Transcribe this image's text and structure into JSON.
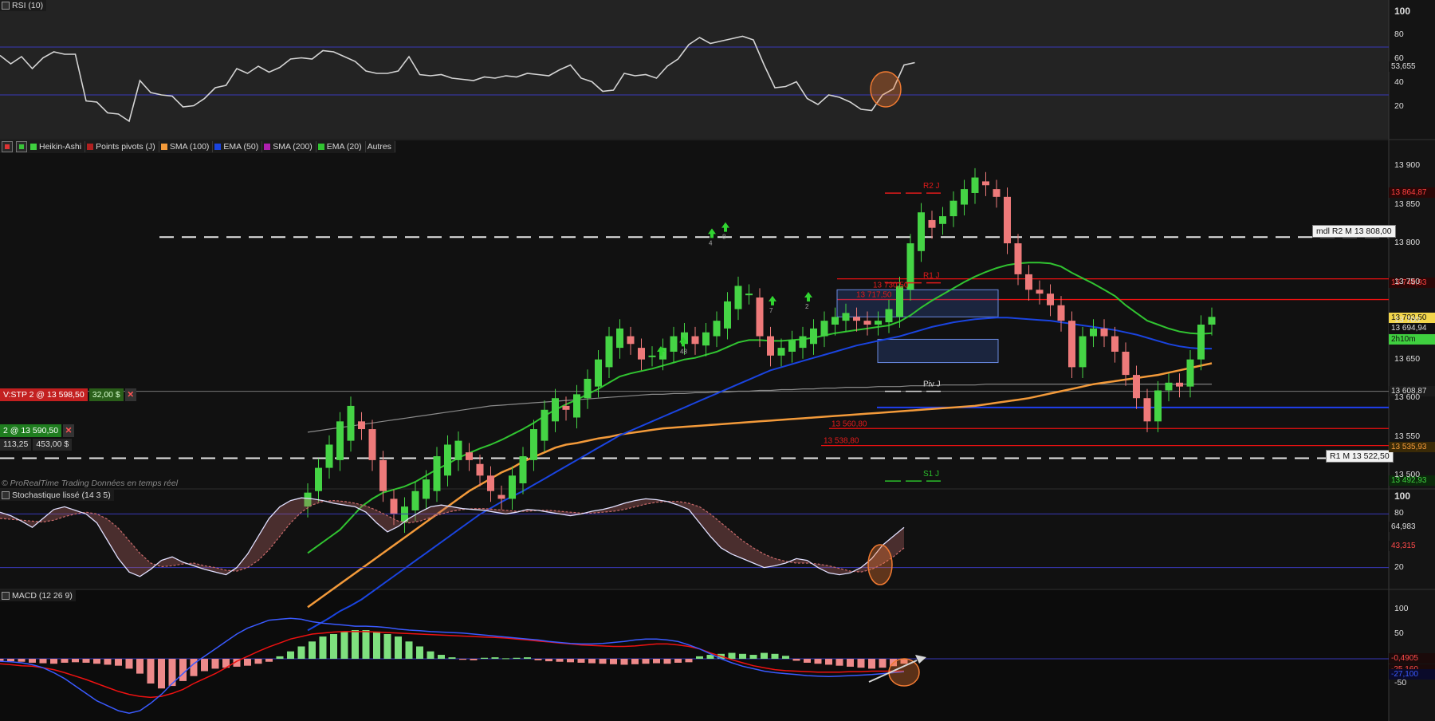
{
  "rsi": {
    "title": "RSI (10)",
    "axis": [
      "100",
      "80",
      "60",
      "40",
      "20"
    ],
    "value_tag": "53,655",
    "series": [
      63,
      56,
      62,
      52,
      61,
      66,
      64,
      64,
      25,
      24,
      15,
      14,
      8,
      42,
      32,
      30,
      29,
      20,
      21,
      27,
      36,
      38,
      52,
      48,
      54,
      49,
      53,
      60,
      61,
      60,
      67,
      66,
      62,
      58,
      50,
      48,
      48,
      50,
      62,
      47,
      46,
      47,
      44,
      43,
      42,
      45,
      44,
      46,
      45,
      48,
      47,
      46,
      51,
      55,
      44,
      41,
      33,
      34,
      48,
      46,
      47,
      44,
      54,
      60,
      72,
      78,
      73,
      75,
      77,
      79,
      76,
      55,
      36,
      37,
      41,
      27,
      22,
      30,
      28,
      24,
      18,
      17,
      30,
      35,
      55,
      57
    ]
  },
  "price": {
    "legend": [
      {
        "label": "Heikin-Ashi",
        "color": "#3fcf3f"
      },
      {
        "label": "Points pivots (J)",
        "color": "#b02020"
      },
      {
        "label": "SMA (100)",
        "color": "#f39a3a"
      },
      {
        "label": "EMA (50)",
        "color": "#1a44e0"
      },
      {
        "label": "SMA (200)",
        "color": "#b020b0"
      },
      {
        "label": "EMA (20)",
        "color": "#31c431"
      },
      {
        "label": "Autres",
        "color": ""
      }
    ],
    "axis": [
      "13 900",
      "13 850",
      "13 800",
      "13 750",
      "13 700",
      "13 650",
      "13 600",
      "13 550",
      "13 500"
    ],
    "tags": [
      {
        "text": "13 864,87",
        "price": 13864.87,
        "bg": "#2a0707",
        "fg": "#ff4040"
      },
      {
        "text": "13 748,93",
        "price": 13748.93,
        "bg": "#2a0707",
        "fg": "#ff4040"
      },
      {
        "text": "13 703,50",
        "price": 13703.5,
        "bg": "#f2d54a",
        "fg": "#111"
      },
      {
        "text": "13 694,94",
        "price": 13690,
        "bg": "#111",
        "fg": "#ddd"
      },
      {
        "text": "2h10m",
        "price": 13675,
        "bg": "#3fcf3f",
        "fg": "#111"
      },
      {
        "text": "13 608,87",
        "price": 13608.87,
        "bg": "#1b1b1b",
        "fg": "#ddd"
      },
      {
        "text": "13 535,93",
        "price": 13535.93,
        "bg": "#3a2a07",
        "fg": "#f39a3a"
      },
      {
        "text": "13 492,93",
        "price": 13492.93,
        "bg": "#0b2a0b",
        "fg": "#3fcf3f"
      }
    ],
    "pivots": [
      {
        "label": "R2 J",
        "price": 13864.87
      },
      {
        "label": "R1 J",
        "price": 13748.93
      },
      {
        "label": "Piv J",
        "price": 13608.87
      },
      {
        "label": "S1 J",
        "price": 13492.93
      }
    ],
    "levels": [
      {
        "label": "mdl R2 M 13 808,00",
        "price": 13808
      },
      {
        "label": "R1 M 13 522,50",
        "price": 13522.5
      }
    ],
    "red_lines": [
      {
        "label": "13 730,50",
        "price": 13730.5
      },
      {
        "label": "13 717,50",
        "price": 13717.5
      },
      {
        "label": "13 560,80",
        "price": 13560.8
      },
      {
        "label": "13 538,80",
        "price": 13538.8
      }
    ],
    "order": {
      "label": "V:STP 2 @ 13 598,50",
      "value": "32,00 $",
      "close": "✕"
    },
    "position": {
      "label": "2 @ 13 590,50",
      "close": "✕",
      "pl": "113,25",
      "amount": "453,00 $"
    },
    "signal_numbers": [
      "4",
      "8",
      "48",
      "7",
      "2"
    ],
    "watermark": "© ProRealTime Trading  Données en temps réel",
    "candles": [
      [
        13460,
        13478
      ],
      [
        13480,
        13510
      ],
      [
        13510,
        13540
      ],
      [
        13520,
        13570
      ],
      [
        13545,
        13590
      ],
      [
        13570,
        13560
      ],
      [
        13560,
        13520
      ],
      [
        13520,
        13480
      ],
      [
        13470,
        13450
      ],
      [
        13440,
        13460
      ],
      [
        13455,
        13480
      ],
      [
        13470,
        13495
      ],
      [
        13480,
        13525
      ],
      [
        13500,
        13540
      ],
      [
        13520,
        13545
      ],
      [
        13530,
        13520
      ],
      [
        13515,
        13500
      ],
      [
        13500,
        13480
      ],
      [
        13475,
        13470
      ],
      [
        13470,
        13500
      ],
      [
        13490,
        13525
      ],
      [
        13520,
        13560
      ],
      [
        13545,
        13585
      ],
      [
        13570,
        13600
      ],
      [
        13590,
        13585
      ],
      [
        13575,
        13605
      ],
      [
        13600,
        13625
      ],
      [
        13615,
        13650
      ],
      [
        13640,
        13680
      ],
      [
        13665,
        13690
      ],
      [
        13680,
        13670
      ],
      [
        13665,
        13650
      ],
      [
        13655,
        13655
      ],
      [
        13650,
        13665
      ],
      [
        13660,
        13680
      ],
      [
        13670,
        13685
      ],
      [
        13680,
        13670
      ],
      [
        13668,
        13685
      ],
      [
        13680,
        13700
      ],
      [
        13690,
        13725
      ],
      [
        13715,
        13745
      ],
      [
        13735,
        13735
      ],
      [
        13730,
        13680
      ],
      [
        13680,
        13655
      ],
      [
        13655,
        13665
      ],
      [
        13660,
        13675
      ],
      [
        13665,
        13680
      ],
      [
        13670,
        13690
      ],
      [
        13680,
        13700
      ],
      [
        13695,
        13705
      ],
      [
        13700,
        13710
      ],
      [
        13705,
        13700
      ],
      [
        13700,
        13695
      ],
      [
        13695,
        13700
      ],
      [
        13698,
        13715
      ],
      [
        13705,
        13745
      ],
      [
        13740,
        13800
      ],
      [
        13790,
        13840
      ],
      [
        13830,
        13820
      ],
      [
        13825,
        13835
      ],
      [
        13835,
        13855
      ],
      [
        13850,
        13870
      ],
      [
        13865,
        13885
      ],
      [
        13880,
        13875
      ],
      [
        13870,
        13860
      ],
      [
        13860,
        13800
      ],
      [
        13800,
        13760
      ],
      [
        13760,
        13740
      ],
      [
        13740,
        13735
      ],
      [
        13735,
        13720
      ],
      [
        13720,
        13700
      ],
      [
        13700,
        13640
      ],
      [
        13640,
        13680
      ],
      [
        13680,
        13690
      ],
      [
        13690,
        13680
      ],
      [
        13680,
        13660
      ],
      [
        13660,
        13630
      ],
      [
        13630,
        13600
      ],
      [
        13600,
        13570
      ],
      [
        13570,
        13610
      ],
      [
        13610,
        13620
      ],
      [
        13620,
        13615
      ],
      [
        13615,
        13650
      ],
      [
        13650,
        13695
      ],
      [
        13695,
        13705
      ]
    ],
    "ema20": [
      13400,
      13410,
      13420,
      13430,
      13445,
      13460,
      13470,
      13478,
      13482,
      13486,
      13492,
      13500,
      13508,
      13515,
      13523,
      13529,
      13535,
      13540,
      13546,
      13553,
      13560,
      13568,
      13577,
      13585,
      13592,
      13598,
      13605,
      13612,
      13620,
      13628,
      13632,
      13635,
      13638,
      13642,
      13646,
      13650,
      13652,
      13656,
      13660,
      13666,
      13672,
      13675,
      13675,
      13674,
      13674,
      13675,
      13676,
      13678,
      13681,
      13684,
      13686,
      13688,
      13690,
      13692,
      13694,
      13699,
      13707,
      13717,
      13726,
      13734,
      13742,
      13750,
      13757,
      13763,
      13768,
      13772,
      13774,
      13775,
      13775,
      13774,
      13770,
      13762,
      13755,
      13748,
      13740,
      13732,
      13720,
      13710,
      13700,
      13695,
      13690,
      13686,
      13684,
      13683,
      13684
    ],
    "ema50": [
      13300,
      13308,
      13316,
      13325,
      13332,
      13340,
      13350,
      13360,
      13370,
      13380,
      13390,
      13400,
      13410,
      13420,
      13430,
      13440,
      13450,
      13458,
      13466,
      13473,
      13480,
      13488,
      13496,
      13504,
      13512,
      13520,
      13528,
      13536,
      13544,
      13552,
      13558,
      13564,
      13570,
      13576,
      13582,
      13588,
      13594,
      13600,
      13606,
      13612,
      13618,
      13624,
      13630,
      13636,
      13640,
      13644,
      13648,
      13652,
      13656,
      13660,
      13664,
      13668,
      13671,
      13674,
      13677,
      13680,
      13684,
      13688,
      13692,
      13695,
      13698,
      13700,
      13702,
      13703,
      13704,
      13704,
      13703,
      13702,
      13701,
      13700,
      13698,
      13696,
      13694,
      13692,
      13690,
      13688,
      13685,
      13682,
      13678,
      13674,
      13670,
      13667,
      13665,
      13664,
      13664
    ],
    "sma100": [
      13330,
      13340,
      13350,
      13360,
      13370,
      13380,
      13390,
      13400,
      13410,
      13420,
      13430,
      13440,
      13450,
      13460,
      13470,
      13480,
      13488,
      13496,
      13504,
      13510,
      13518,
      13524,
      13530,
      13536,
      13540,
      13542,
      13545,
      13548,
      13550,
      13553,
      13555,
      13557,
      13559,
      13561,
      13562,
      13563,
      13564,
      13565,
      13566,
      13567,
      13568,
      13569,
      13570,
      13571,
      13572,
      13573,
      13574,
      13575,
      13576,
      13577,
      13578,
      13579,
      13580,
      13581,
      13582,
      13583,
      13584,
      13585,
      13586,
      13587,
      13588,
      13589,
      13590,
      13592,
      13594,
      13596,
      13598,
      13600,
      13603,
      13606,
      13609,
      13612,
      13615,
      13618,
      13620,
      13622,
      13624,
      13626,
      13628,
      13630,
      13633,
      13636,
      13639,
      13642,
      13645
    ],
    "sma200": [
      13556,
      13558,
      13560,
      13562,
      13564,
      13566,
      13568,
      13570,
      13572,
      13574,
      13576,
      13578,
      13580,
      13582,
      13584,
      13586,
      13588,
      13590,
      13591,
      13592,
      13593,
      13594,
      13595,
      13596,
      13597,
      13598,
      13599,
      13600,
      13601,
      13602,
      13603,
      13604,
      13605,
      13605,
      13606,
      13606,
      13607,
      13607,
      13608,
      13608,
      13609,
      13609,
      13610,
      13610,
      13611,
      13611,
      13612,
      13612,
      13613,
      13613,
      13614,
      13614,
      13614,
      13615,
      13615,
      13615,
      13616,
      13616,
      13616,
      13617,
      13617,
      13617,
      13617,
      13618,
      13618,
      13618,
      13618,
      13618,
      13618,
      13618,
      13618,
      13618,
      13618,
      13618,
      13618,
      13618,
      13618,
      13618,
      13618,
      13618,
      13618,
      13618,
      13618,
      13618,
      13618
    ]
  },
  "stoch": {
    "title": "Stochastique lissé (14 3 5)",
    "axis": [
      "100",
      "80",
      "20"
    ],
    "tags": [
      {
        "text": "64,983",
        "value": 64.983,
        "fg": "#ddd"
      },
      {
        "text": "43,315",
        "value": 43.315,
        "fg": "#ff4a4a"
      }
    ],
    "k": [
      82,
      78,
      72,
      65,
      75,
      85,
      88,
      84,
      80,
      70,
      50,
      30,
      15,
      10,
      18,
      28,
      32,
      26,
      22,
      18,
      15,
      12,
      20,
      35,
      55,
      75,
      88,
      95,
      98,
      97,
      95,
      92,
      90,
      88,
      82,
      70,
      60,
      66,
      75,
      82,
      88,
      90,
      88,
      86,
      85,
      84,
      82,
      80,
      82,
      85,
      84,
      82,
      80,
      78,
      80,
      83,
      85,
      88,
      92,
      95,
      97,
      96,
      94,
      90,
      85,
      70,
      55,
      42,
      35,
      30,
      25,
      20,
      22,
      25,
      30,
      28,
      20,
      14,
      12,
      14,
      20,
      30,
      45,
      55,
      65
    ],
    "d": [
      75,
      74,
      73,
      72,
      71,
      73,
      77,
      80,
      82,
      80,
      74,
      64,
      50,
      36,
      25,
      21,
      22,
      24,
      25,
      22,
      20,
      17,
      16,
      20,
      28,
      40,
      55,
      70,
      82,
      90,
      94,
      95,
      94,
      92,
      89,
      84,
      78,
      72,
      70,
      72,
      76,
      80,
      83,
      85,
      86,
      86,
      85,
      84,
      83,
      83,
      84,
      84,
      83,
      82,
      81,
      81,
      82,
      83,
      85,
      88,
      91,
      93,
      94,
      94,
      92,
      88,
      80,
      70,
      60,
      50,
      42,
      35,
      30,
      27,
      25,
      25,
      24,
      22,
      19,
      16,
      15,
      18,
      24,
      32,
      42
    ]
  },
  "macd": {
    "title": "MACD (12 26 9)",
    "axis": [
      "100",
      "50",
      "-50"
    ],
    "tags": [
      {
        "text": "-0,4905",
        "value": -0.4905,
        "bg": "#1a0a0a",
        "fg": "#ff4a4a"
      },
      {
        "text": "-25,160",
        "value": -22,
        "bg": "#1a0a0a",
        "fg": "#ff4a4a"
      },
      {
        "text": "-27,100",
        "value": -32,
        "bg": "#0a0a2a",
        "fg": "#3a5aff"
      }
    ],
    "hist": [
      -4,
      -5,
      -6,
      -8,
      -9,
      -10,
      -8,
      -7,
      -8,
      -10,
      -12,
      -14,
      -20,
      -30,
      -50,
      -60,
      -55,
      -45,
      -35,
      -25,
      -20,
      -18,
      -16,
      -14,
      -10,
      -6,
      5,
      15,
      25,
      35,
      45,
      50,
      55,
      58,
      58,
      55,
      50,
      45,
      35,
      25,
      15,
      8,
      3,
      -2,
      -3,
      2,
      3,
      1,
      2,
      3,
      -3,
      -5,
      -6,
      -7,
      -8,
      -9,
      -10,
      -11,
      -12,
      -11,
      -10,
      -9,
      -10,
      -8,
      -7,
      5,
      8,
      10,
      12,
      10,
      8,
      12,
      10,
      6,
      -4,
      -8,
      -10,
      -12,
      -14,
      -16,
      -18,
      -20,
      -18,
      -15,
      -10
    ],
    "signal": [
      -10,
      -12,
      -14,
      -15,
      -18,
      -22,
      -28,
      -35,
      -42,
      -50,
      -58,
      -66,
      -72,
      -76,
      -78,
      -76,
      -70,
      -62,
      -50,
      -40,
      -30,
      -18,
      -5,
      5,
      15,
      24,
      32,
      40,
      45,
      50,
      52,
      54,
      55,
      55,
      55,
      54,
      53,
      52,
      51,
      50,
      49,
      48,
      47,
      46,
      45,
      44,
      43,
      42,
      40,
      38,
      36,
      34,
      32,
      30,
      28,
      27,
      26,
      25,
      25,
      26,
      28,
      30,
      30,
      28,
      25,
      20,
      12,
      5,
      -2,
      -8,
      -14,
      -18,
      -22,
      -24,
      -25,
      -26,
      -27,
      -27,
      -27,
      -26,
      -26,
      -25,
      -25,
      -25,
      -25
    ],
    "macdline": [
      -5,
      -6,
      -8,
      -12,
      -18,
      -28,
      -40,
      -55,
      -70,
      -85,
      -95,
      -105,
      -110,
      -105,
      -90,
      -72,
      -50,
      -30,
      -10,
      5,
      20,
      35,
      50,
      62,
      70,
      78,
      80,
      82,
      80,
      75,
      72,
      70,
      68,
      66,
      66,
      65,
      63,
      60,
      58,
      57,
      55,
      54,
      53,
      52,
      50,
      48,
      46,
      44,
      42,
      40,
      38,
      35,
      33,
      31,
      30,
      30,
      31,
      33,
      35,
      38,
      40,
      40,
      38,
      35,
      28,
      20,
      10,
      0,
      -8,
      -15,
      -20,
      -25,
      -28,
      -30,
      -32,
      -34,
      -35,
      -36,
      -35,
      -34,
      -33,
      -32,
      -30,
      -28,
      -26
    ]
  }
}
